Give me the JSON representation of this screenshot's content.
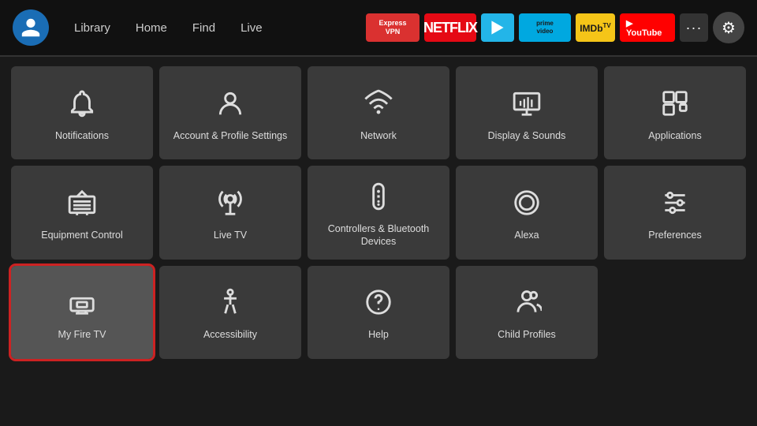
{
  "navbar": {
    "links": [
      "Library",
      "Home",
      "Find",
      "Live"
    ],
    "apps": [
      {
        "id": "expressvpn",
        "label": "Express\nVPN",
        "class": "app-expressvpn"
      },
      {
        "id": "netflix",
        "label": "NETFLIX",
        "class": "app-netflix"
      },
      {
        "id": "freevee",
        "label": "▶",
        "class": "app-freevee"
      },
      {
        "id": "prime",
        "label": "prime\nvideo",
        "class": "app-prime"
      },
      {
        "id": "imdb",
        "label": "IMDbᴛᴠ",
        "class": "app-imdb"
      },
      {
        "id": "youtube",
        "label": "▶ YouTube",
        "class": "app-youtube"
      }
    ],
    "more_label": "···",
    "settings_icon": "⚙"
  },
  "tiles": [
    {
      "id": "notifications",
      "label": "Notifications",
      "icon": "bell"
    },
    {
      "id": "account-profile",
      "label": "Account & Profile Settings",
      "icon": "person"
    },
    {
      "id": "network",
      "label": "Network",
      "icon": "wifi"
    },
    {
      "id": "display-sounds",
      "label": "Display & Sounds",
      "icon": "display"
    },
    {
      "id": "applications",
      "label": "Applications",
      "icon": "apps"
    },
    {
      "id": "equipment-control",
      "label": "Equipment Control",
      "icon": "tv"
    },
    {
      "id": "live-tv",
      "label": "Live TV",
      "icon": "antenna"
    },
    {
      "id": "controllers-bluetooth",
      "label": "Controllers & Bluetooth Devices",
      "icon": "remote"
    },
    {
      "id": "alexa",
      "label": "Alexa",
      "icon": "alexa"
    },
    {
      "id": "preferences",
      "label": "Preferences",
      "icon": "sliders"
    },
    {
      "id": "my-fire-tv",
      "label": "My Fire TV",
      "icon": "firetv",
      "selected": true
    },
    {
      "id": "accessibility",
      "label": "Accessibility",
      "icon": "accessibility"
    },
    {
      "id": "help",
      "label": "Help",
      "icon": "help"
    },
    {
      "id": "child-profiles",
      "label": "Child Profiles",
      "icon": "child-profiles"
    }
  ]
}
